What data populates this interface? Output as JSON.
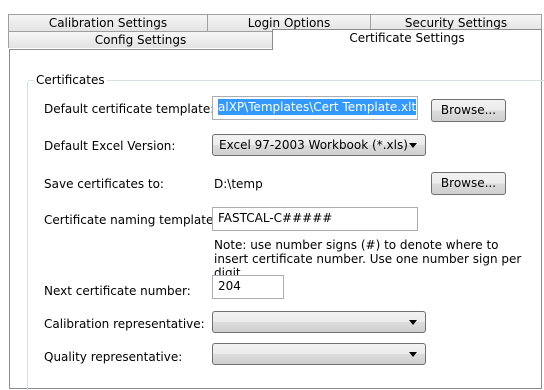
{
  "tabs": {
    "row1": [
      "Calibration Settings",
      "Login Options",
      "Security Settings"
    ],
    "row2": [
      "Config Settings",
      "Certificate Settings"
    ],
    "active": "Certificate Settings"
  },
  "group": {
    "legend": "Certificates"
  },
  "fields": {
    "template_label": "Default certificate template:",
    "template_value": "alXP\\Templates\\Cert Template.xlt",
    "browse_label": "Browse...",
    "excel_label": "Default Excel Version:",
    "excel_value": "Excel 97-2003 Workbook (*.xls)",
    "save_label": "Save certificates to:",
    "save_value": "D:\\temp",
    "naming_label": "Certificate naming template:",
    "naming_value": "FASTCAL-C#####",
    "note": "Note: use number signs (#) to denote where to insert certificate number. Use one number sign per digit.",
    "next_label": "Next certificate number:",
    "next_value": "204",
    "cal_rep_label": "Calibration representative:",
    "cal_rep_value": "",
    "qual_rep_label": "Quality representative:",
    "qual_rep_value": ""
  },
  "icons": {
    "dropdown": "chevron-down-icon"
  }
}
